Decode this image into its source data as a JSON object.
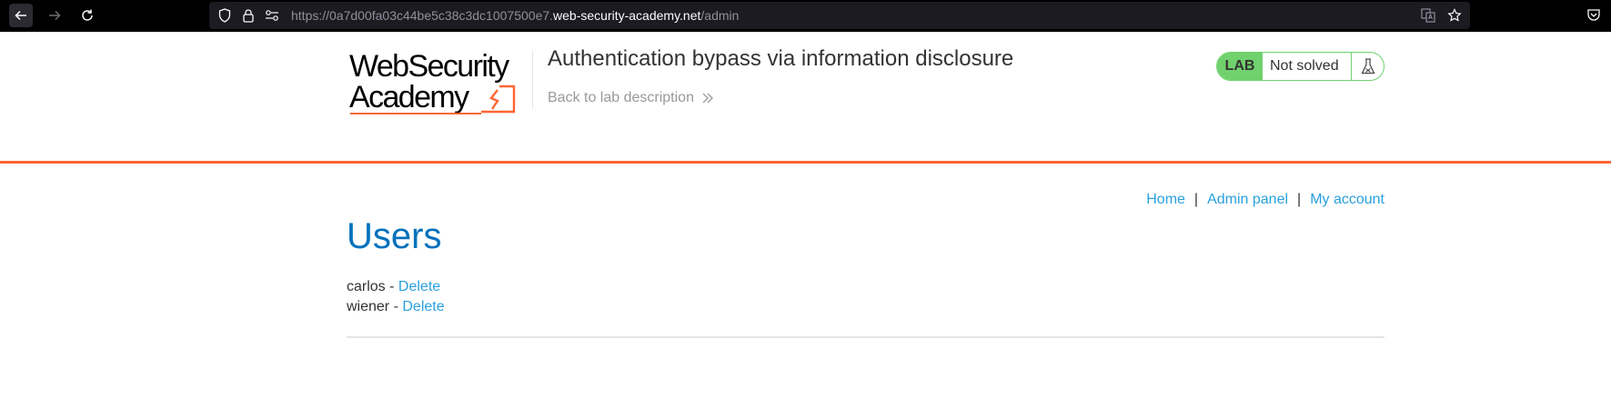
{
  "browser": {
    "url_prefix": "https://0a7d00fa03c44be5c38c3dc1007500e7.",
    "url_domain": "web-security-academy.net",
    "url_path": "/admin"
  },
  "header": {
    "logo_line1": "WebSecurity",
    "logo_line2": "Academy",
    "lab_title": "Authentication bypass via information disclosure",
    "back_link": "Back to lab description",
    "lab_badge": "LAB",
    "lab_status": "Not solved"
  },
  "nav": {
    "home": "Home",
    "sep1": "|",
    "admin_panel": "Admin panel",
    "sep2": "|",
    "my_account": "My account"
  },
  "main": {
    "title": "Users",
    "users": [
      {
        "name": "carlos",
        "separator": " - ",
        "action": "Delete"
      },
      {
        "name": "wiener",
        "separator": " - ",
        "action": "Delete"
      }
    ]
  },
  "colors": {
    "accent_orange": "#ff6633",
    "lab_green": "#70d16d",
    "title_blue": "#0071bc",
    "link_blue": "#29a0dd"
  }
}
